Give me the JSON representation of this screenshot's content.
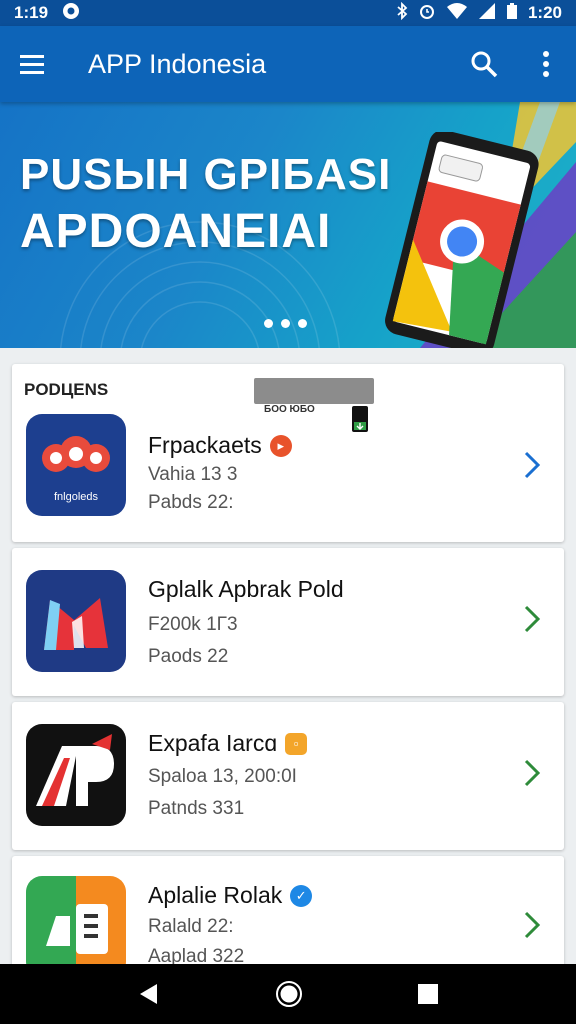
{
  "status_bar": {
    "time": "1:19",
    "right_time": "1:20",
    "icons": [
      "circle-notification-icon",
      "bluetooth-icon",
      "alarm-icon",
      "wifi-icon",
      "cell-signal-icon",
      "battery-icon"
    ]
  },
  "app_bar": {
    "title": "APP Indonesia",
    "icons": [
      "menu-icon",
      "search-icon",
      "more-vert-icon"
    ]
  },
  "banner": {
    "line1": "PUSЫH GPIБASI",
    "line2": "APDOANEIAI",
    "page_count": 3
  },
  "section": {
    "title": "PODЦENS",
    "overlay_text": "БОО ЮБО"
  },
  "apps": [
    {
      "name": "Frpackaets",
      "line1": "Vahia 13 3",
      "line2": "Pabds 22:",
      "icon": "red-cluster-app-icon",
      "icon_text": "fnlgoleds",
      "badge_color": "#e8532b",
      "chevron_color": "#1a6fd1"
    },
    {
      "name": "Gplalk Apbrak Pold",
      "line1": "F200k 1Г3",
      "line2": "Paods 22",
      "icon": "m-shape-app-icon",
      "badge_color": "",
      "chevron_color": "#2e8b3a"
    },
    {
      "name": "Expafa Iarcɑ",
      "line1": "Spaloa 13, 200:0I",
      "line2": "Patnds 331",
      "icon": "ap-letters-app-icon",
      "badge_color": "#f3a52a",
      "chevron_color": "#2e8b3a"
    },
    {
      "name": "Aplalie Rolak",
      "line1": "Ralald 22:",
      "line2": "Aaplad 322",
      "icon": "green-orange-app-icon",
      "badge_color": "#1e88e5",
      "chevron_color": "#2e8b3a"
    }
  ],
  "nav_bar": {
    "icons": [
      "back-triangle-icon",
      "home-circle-icon",
      "recents-square-icon"
    ]
  }
}
